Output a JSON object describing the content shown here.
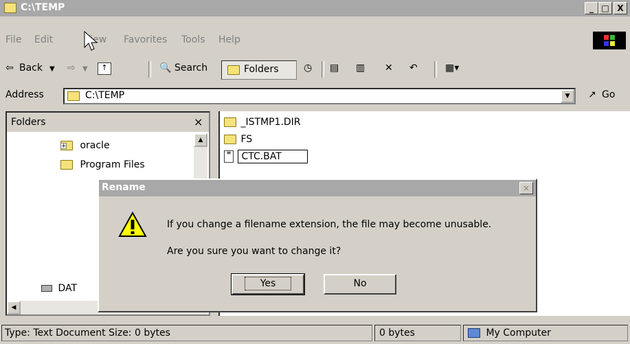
{
  "window": {
    "title": "C:\\TEMP",
    "min": "_",
    "max": "□",
    "close": "X"
  },
  "menu": {
    "file": "File",
    "edit": "Edit",
    "view": "View",
    "favorites": "Favorites",
    "tools": "Tools",
    "help": "Help"
  },
  "toolbar": {
    "back": "Back",
    "search": "Search",
    "folders": "Folders"
  },
  "address": {
    "label": "Address",
    "value": "C:\\TEMP",
    "go": "Go"
  },
  "folders_pane": {
    "title": "Folders",
    "close": "×",
    "items": [
      "oracle",
      "Program Files",
      "DAT"
    ]
  },
  "files": [
    {
      "name": "_ISTMP1.DIR"
    },
    {
      "name": "FS"
    },
    {
      "name": "CTC.BAT"
    }
  ],
  "status": {
    "type": "Type: Text Document Size: 0 bytes",
    "size": "0 bytes",
    "zone": "My Computer"
  },
  "dialog": {
    "title": "Rename",
    "close": "×",
    "message": "If you change a filename extension, the file may become unusable.",
    "question": "Are you sure you want to change it?",
    "yes": "Yes",
    "no": "No"
  }
}
